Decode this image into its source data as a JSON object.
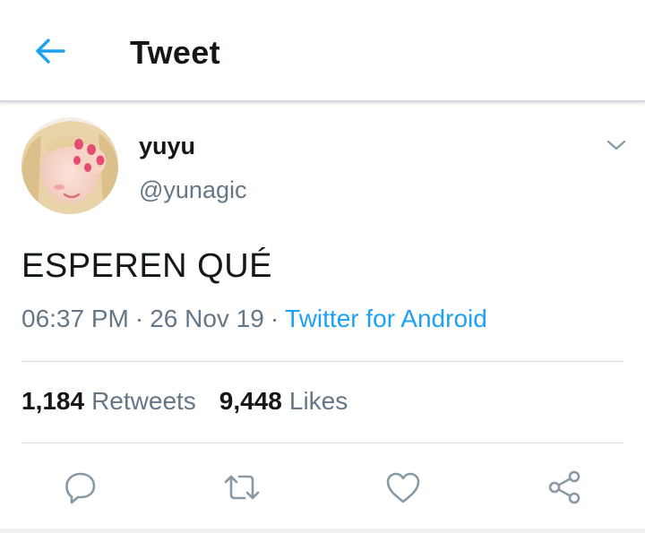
{
  "header": {
    "title": "Tweet",
    "back_icon": "arrow-left-icon"
  },
  "author": {
    "display_name": "yuyu",
    "handle": "@yunagic",
    "avatar_icon": "avatar-photo"
  },
  "tweet": {
    "text": "ESPEREN QUÉ",
    "time": "06:37 PM",
    "date": "26 Nov 19",
    "separator": "·",
    "source": "Twitter for Android"
  },
  "stats": {
    "retweets_count": "1,184",
    "retweets_label": "Retweets",
    "likes_count": "9,448",
    "likes_label": "Likes"
  },
  "actions": [
    "reply-icon",
    "retweet-icon",
    "like-icon",
    "share-icon"
  ],
  "colors": {
    "accent": "#1da1f2",
    "primary_text": "#14171a",
    "secondary_text": "#657786",
    "icon_gray": "#8899a6",
    "divider": "#d8dde2"
  }
}
